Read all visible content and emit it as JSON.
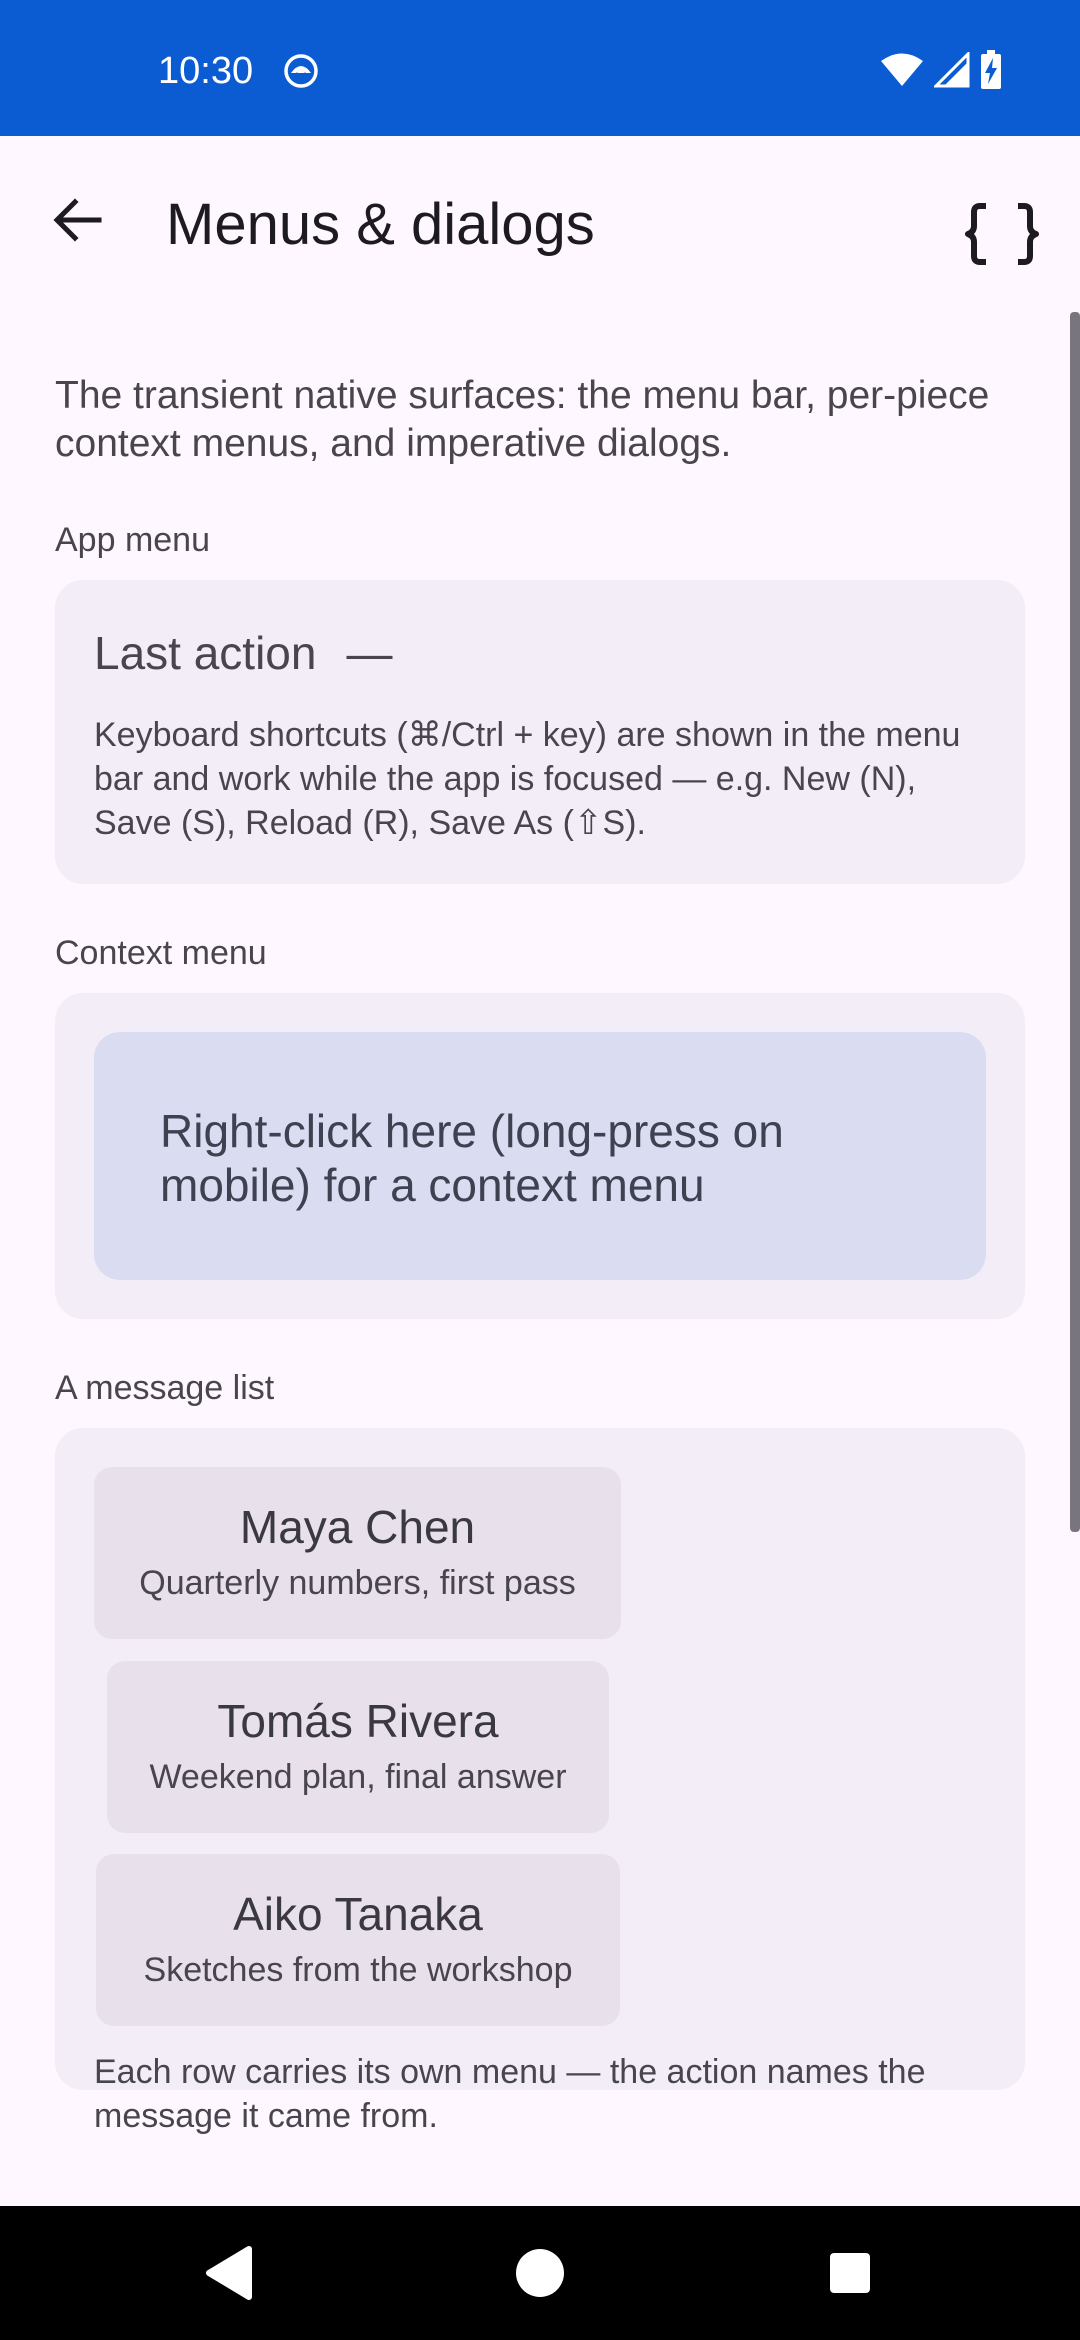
{
  "status_bar": {
    "time": "10:30",
    "background": "#0B5BD3",
    "icons": [
      "app-notification-icon",
      "wifi-icon",
      "cell-signal-icon",
      "battery-charging-icon"
    ]
  },
  "app_bar": {
    "title": "Menus & dialogs",
    "back_icon": "arrow-back-icon",
    "action_icon": "code-braces-icon"
  },
  "intro": "The transient native surfaces: the menu bar, per-piece context menus, and imperative dialogs.",
  "app_menu": {
    "label": "App menu",
    "last_action_label": "Last action",
    "last_action_value": "—",
    "note": "Keyboard shortcuts (⌘/Ctrl + key) are shown in the menu bar and work while the app is focused — e.g. New (N), Save (S), Reload (R), Save As (⇧S)."
  },
  "context_menu": {
    "label": "Context menu",
    "target_text": "Right-click here (long-press on mobile) for a context menu"
  },
  "message_list": {
    "label": "A message list",
    "items": [
      {
        "name": "Maya Chen",
        "subject": "Quarterly numbers, first pass"
      },
      {
        "name": "Tomás Rivera",
        "subject": "Weekend plan, final answer"
      },
      {
        "name": "Aiko Tanaka",
        "subject": "Sketches from the workshop"
      }
    ],
    "note": "Each row carries its own menu — the action names the message it came from."
  },
  "nav_bar": {
    "icons": [
      "nav-back-icon",
      "nav-home-icon",
      "nav-recents-icon"
    ]
  }
}
